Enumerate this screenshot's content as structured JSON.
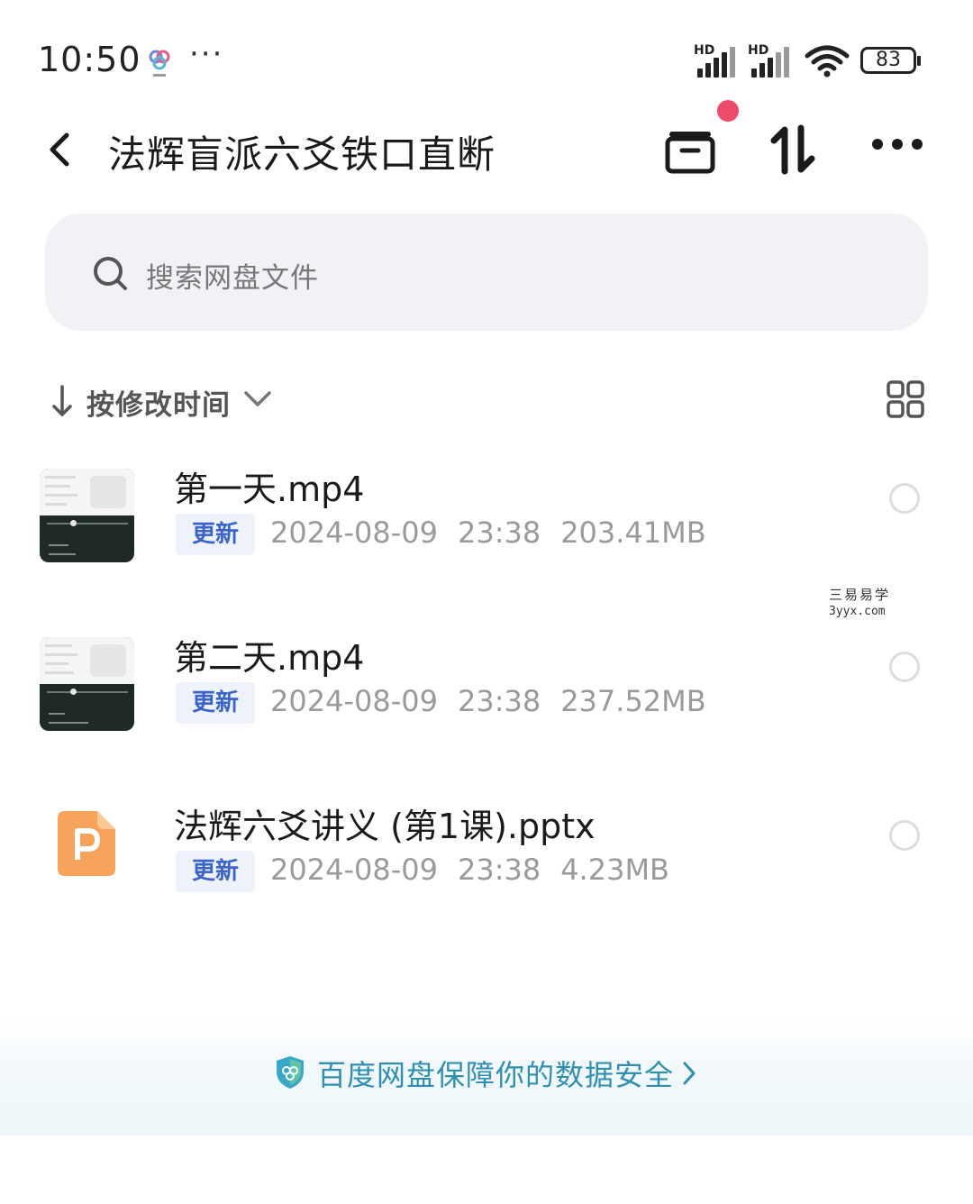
{
  "status_bar": {
    "time": "10:50",
    "signal_1_label": "HD",
    "signal_2_label": "HD",
    "battery": "83"
  },
  "header": {
    "title": "法辉盲派六爻铁口直断"
  },
  "search": {
    "placeholder": "搜索网盘文件"
  },
  "sort": {
    "label": "按修改时间"
  },
  "files": [
    {
      "name": "第一天.mp4",
      "badge": "更新",
      "date": "2024-08-09",
      "time": "23:38",
      "size": "203.41MB",
      "type": "video"
    },
    {
      "name": "第二天.mp4",
      "badge": "更新",
      "date": "2024-08-09",
      "time": "23:38",
      "size": "237.52MB",
      "type": "video"
    },
    {
      "name": "法辉六爻讲义 (第1课).pptx",
      "badge": "更新",
      "date": "2024-08-09",
      "time": "23:38",
      "size": "4.23MB",
      "type": "pptx"
    }
  ],
  "watermark": {
    "line1": "三易易学",
    "line2": "3yyx.com"
  },
  "footer": {
    "text": "百度网盘保障你的数据安全"
  },
  "colors": {
    "accent_blue": "#3b63c8",
    "footer_teal": "#2f8fb0",
    "notify_red": "#ee4a6a",
    "ppt_orange": "#f7a35c"
  }
}
